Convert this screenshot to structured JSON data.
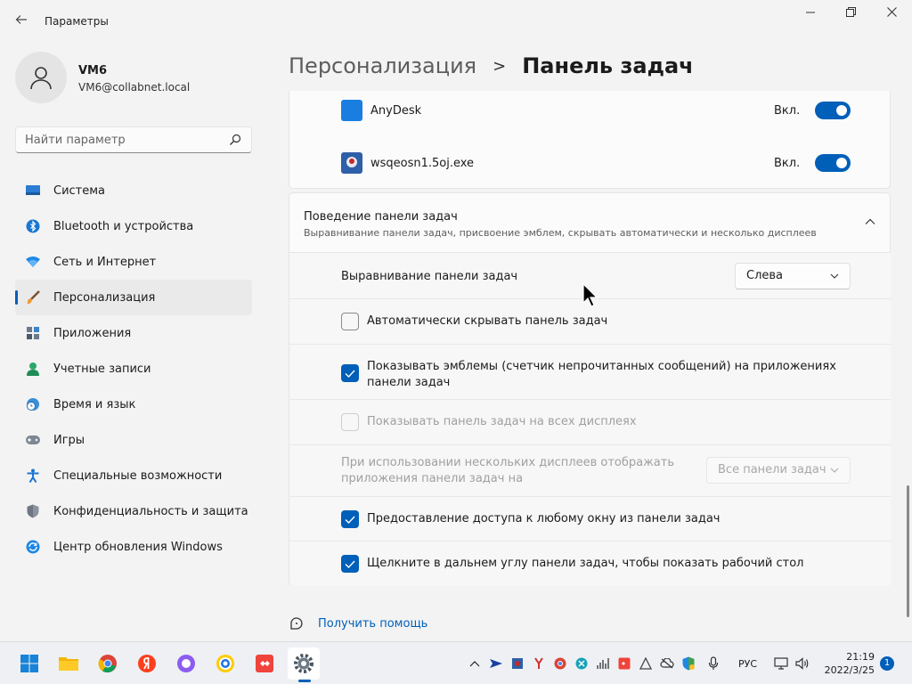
{
  "window": {
    "title": "Параметры",
    "back_icon": "arrow-left-icon",
    "controls": [
      "minimize-icon",
      "maximize-icon",
      "close-icon"
    ]
  },
  "profile": {
    "name": "VM6",
    "email": "VM6@collabnet.local"
  },
  "search": {
    "placeholder": "Найти параметр"
  },
  "sidebar": {
    "items": [
      {
        "label": "Система",
        "icon": "monitor-icon"
      },
      {
        "label": "Bluetooth и устройства",
        "icon": "bluetooth-icon"
      },
      {
        "label": "Сеть и Интернет",
        "icon": "wifi-icon"
      },
      {
        "label": "Персонализация",
        "icon": "brush-icon",
        "active": true
      },
      {
        "label": "Приложения",
        "icon": "apps-icon"
      },
      {
        "label": "Учетные записи",
        "icon": "person-icon"
      },
      {
        "label": "Время и язык",
        "icon": "globe-clock-icon"
      },
      {
        "label": "Игры",
        "icon": "gamepad-icon"
      },
      {
        "label": "Специальные возможности",
        "icon": "accessibility-icon"
      },
      {
        "label": "Конфиденциальность и защита",
        "icon": "shield-icon"
      },
      {
        "label": "Центр обновления Windows",
        "icon": "update-icon"
      }
    ]
  },
  "header": {
    "parent": "Персонализация",
    "separator": ">",
    "current": "Панель задач"
  },
  "corner_apps": [
    {
      "name": "AnyDesk",
      "state_label": "Вкл.",
      "on": true
    },
    {
      "name": "wsqeosn1.5oj.exe",
      "state_label": "Вкл.",
      "on": true
    }
  ],
  "behavior": {
    "title": "Поведение панели задач",
    "subtitle": "Выравнивание панели задач, присвоение эмблем, скрывать автоматически и несколько дисплеев",
    "alignment": {
      "label": "Выравнивание панели задач",
      "value": "Слева"
    },
    "autohide": {
      "label": "Автоматически скрывать панель задач",
      "checked": false
    },
    "badges": {
      "label_line1": "Показывать эмблемы (счетчик непрочитанных сообщений) на приложениях",
      "label_line2": "панели задач",
      "checked": true
    },
    "all_displays": {
      "label": "Показывать панель задач на всех дисплеях",
      "checked": false,
      "disabled": true
    },
    "multi_display": {
      "label_line1": "При использовании нескольких дисплеев отображать",
      "label_line2": "приложения панели задач на",
      "value": "Все панели задач",
      "disabled": true
    },
    "share_window": {
      "label": "Предоставление доступа к любому окну из панели задач",
      "checked": true
    },
    "far_corner": {
      "label": "Щелкните в дальнем углу панели задач, чтобы показать рабочий стол",
      "checked": true
    }
  },
  "help": {
    "label": "Получить помощь"
  },
  "taskbar": {
    "apps": [
      "windows-start-icon",
      "file-explorer-icon",
      "chrome-icon",
      "yandex-icon",
      "alice-icon",
      "yandex-browser-icon",
      "anydesk-icon",
      "settings-icon"
    ],
    "tray": [
      "chevron-up-icon",
      "tray-app-icon",
      "tray-app-icon",
      "yandex-icon",
      "chrome-icon",
      "tray-app-icon",
      "network-activity-icon",
      "anydesk-icon",
      "cloud-off-icon",
      "defender-icon",
      "microphone-icon"
    ],
    "language": "РУС",
    "time": "21:19",
    "date": "2022/3/25",
    "notifications": "1"
  }
}
